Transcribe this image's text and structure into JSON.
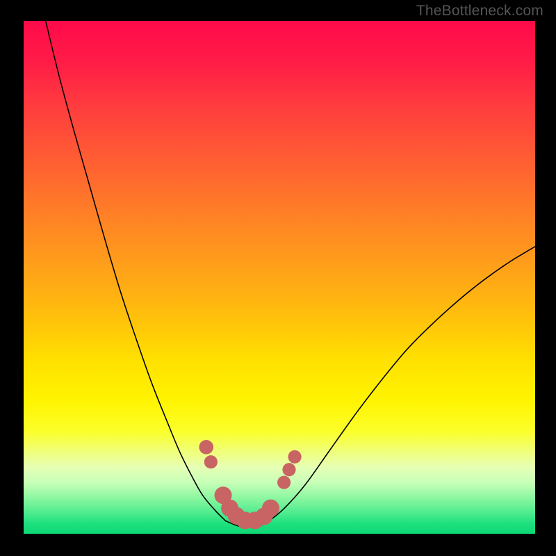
{
  "watermark": "TheBottleneck.com",
  "chart_data": {
    "type": "line",
    "title": "",
    "xlabel": "",
    "ylabel": "",
    "xlim": [
      0,
      100
    ],
    "ylim": [
      0,
      100
    ],
    "grid": false,
    "legend": false,
    "note": "No axis ticks or numeric labels rendered; values are fractional positions in the plot area (0–100) estimated from pixel geometry.",
    "series": [
      {
        "name": "left-curve",
        "x": [
          4.3,
          7,
          10,
          13,
          16,
          19,
          22,
          25,
          28,
          30.5,
          33,
          35,
          37.5,
          39.5
        ],
        "y": [
          100,
          89,
          78,
          67.5,
          57,
          47,
          38,
          29.5,
          22,
          16,
          11,
          7.5,
          4.5,
          2.5
        ]
      },
      {
        "name": "right-curve",
        "x": [
          48,
          51,
          55,
          60,
          65,
          70,
          75,
          80,
          85,
          90,
          95,
          100
        ],
        "y": [
          2.5,
          5,
          9.5,
          16.5,
          23.5,
          30,
          36,
          41,
          45.5,
          49.5,
          53,
          56
        ]
      },
      {
        "name": "floor",
        "x": [
          39.5,
          42,
          44,
          46,
          48
        ],
        "y": [
          2.5,
          1.5,
          1.3,
          1.5,
          2.5
        ]
      }
    ],
    "markers": [
      {
        "x": 35.7,
        "y": 16.9,
        "r": 1.4
      },
      {
        "x": 36.6,
        "y": 14.0,
        "r": 1.3
      },
      {
        "x": 39.0,
        "y": 7.5,
        "r": 1.7
      },
      {
        "x": 40.3,
        "y": 5.0,
        "r": 1.7
      },
      {
        "x": 41.6,
        "y": 3.5,
        "r": 1.7
      },
      {
        "x": 43.3,
        "y": 2.6,
        "r": 1.7
      },
      {
        "x": 45.2,
        "y": 2.6,
        "r": 1.7
      },
      {
        "x": 47.0,
        "y": 3.4,
        "r": 1.7
      },
      {
        "x": 48.3,
        "y": 5.0,
        "r": 1.7
      },
      {
        "x": 50.9,
        "y": 10.0,
        "r": 1.3
      },
      {
        "x": 51.9,
        "y": 12.5,
        "r": 1.3
      },
      {
        "x": 53.0,
        "y": 15.0,
        "r": 1.3
      }
    ],
    "background_gradient": {
      "direction": "vertical",
      "stops": [
        {
          "pct": 0,
          "hex": "#ff0a4a"
        },
        {
          "pct": 50,
          "hex": "#ffba0e"
        },
        {
          "pct": 75,
          "hex": "#fff400"
        },
        {
          "pct": 100,
          "hex": "#0cd874"
        }
      ]
    }
  }
}
